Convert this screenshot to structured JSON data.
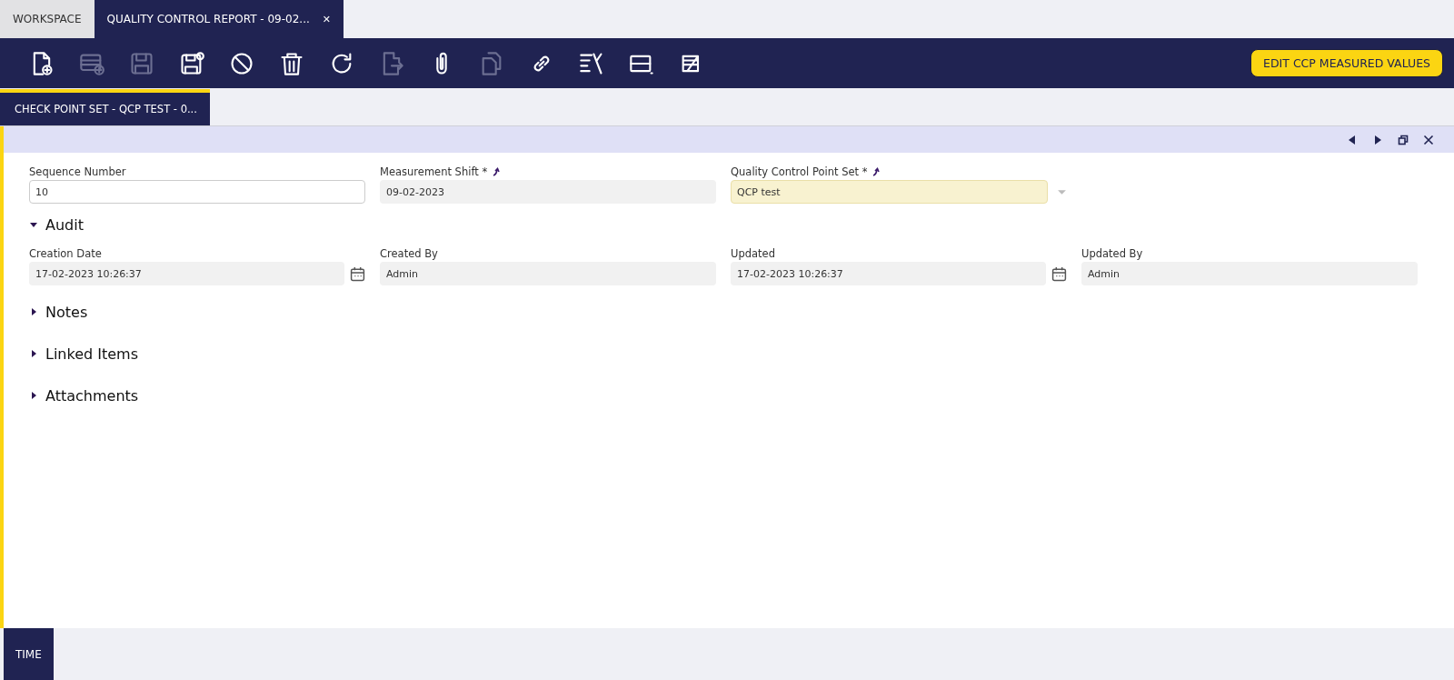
{
  "window_tabs": [
    {
      "label": "WORKSPACE",
      "selected": false
    },
    {
      "label": "QUALITY CONTROL REPORT - 09-02...",
      "selected": true,
      "close": "✕"
    }
  ],
  "toolbar": {
    "buttons": [
      {
        "kind": "new-doc",
        "disabled": false
      },
      {
        "kind": "new-row",
        "disabled": true
      },
      {
        "kind": "save",
        "disabled": true
      },
      {
        "kind": "save-close",
        "disabled": false
      },
      {
        "kind": "cancel",
        "disabled": false
      },
      {
        "kind": "delete",
        "disabled": false
      },
      {
        "kind": "refresh",
        "disabled": false
      },
      {
        "kind": "export",
        "disabled": true
      },
      {
        "kind": "attach",
        "disabled": false
      },
      {
        "kind": "copy",
        "disabled": true
      },
      {
        "kind": "link",
        "disabled": false
      },
      {
        "kind": "tools",
        "disabled": false
      },
      {
        "kind": "grid",
        "disabled": false
      },
      {
        "kind": "notes",
        "disabled": false
      }
    ],
    "action_button": "EDIT CCP MEASURED VALUES"
  },
  "record_tabs": [
    {
      "label": "CHECK POINT SET - QCP TEST - 0...",
      "selected": true
    }
  ],
  "form": {
    "fields": [
      {
        "label": "Sequence Number",
        "value": "10",
        "kind": "text",
        "linked": false
      },
      {
        "label": "Measurement Shift *",
        "value": "09-02-2023",
        "kind": "readonly",
        "linked": true
      },
      {
        "label": "Quality Control Point Set *",
        "value": "QCP test",
        "kind": "combo",
        "linked": true
      }
    ]
  },
  "sections": [
    {
      "title": "Audit",
      "expanded": true,
      "fields": [
        {
          "label": "Creation Date",
          "value": "17-02-2023 10:26:37",
          "kind": "date"
        },
        {
          "label": "Created By",
          "value": "Admin",
          "kind": "readonly"
        },
        {
          "label": "Updated",
          "value": "17-02-2023 10:26:37",
          "kind": "date"
        },
        {
          "label": "Updated By",
          "value": "Admin",
          "kind": "readonly"
        }
      ]
    },
    {
      "title": "Notes",
      "expanded": false
    },
    {
      "title": "Linked Items",
      "expanded": false
    },
    {
      "title": "Attachments",
      "expanded": false
    }
  ],
  "bottom_tabs": [
    {
      "label": "TIME",
      "selected": true
    }
  ]
}
